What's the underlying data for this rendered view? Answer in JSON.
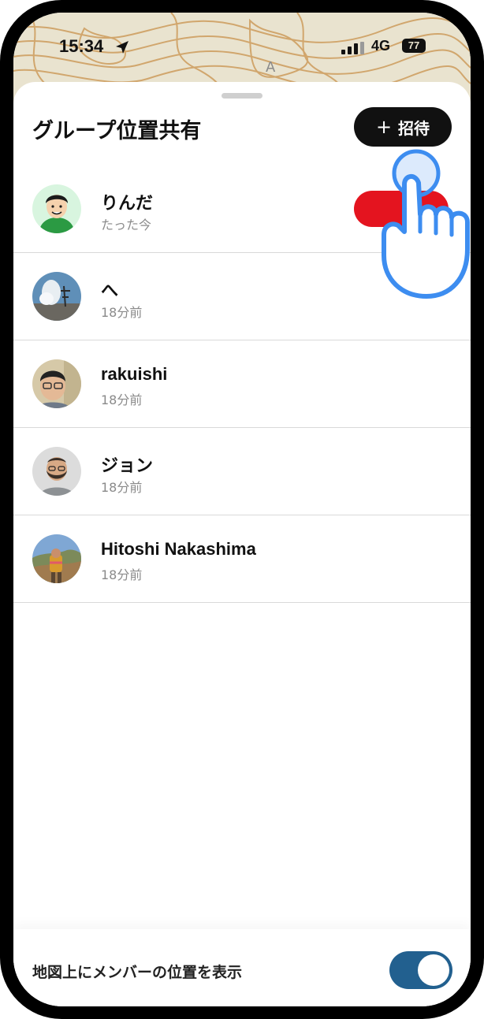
{
  "status_bar": {
    "time": "15:34",
    "network": "4G",
    "battery": "77"
  },
  "sheet": {
    "title": "グループ位置共有",
    "invite_button": {
      "plus": "+",
      "label": "招待"
    }
  },
  "members": [
    {
      "name": "りんだ",
      "time": "たった今"
    },
    {
      "name": "へ",
      "time": "18分前"
    },
    {
      "name": "rakuishi",
      "time": "18分前"
    },
    {
      "name": "ジョン",
      "time": "18分前"
    },
    {
      "name": "Hitoshi Nakashima",
      "time": "18分前"
    }
  ],
  "footer": {
    "label": "地図上にメンバーの位置を表示",
    "toggle_on": true
  },
  "colors": {
    "accent_red": "#e4141f",
    "toggle": "#22608f",
    "hand_outline": "#3d8df0"
  }
}
